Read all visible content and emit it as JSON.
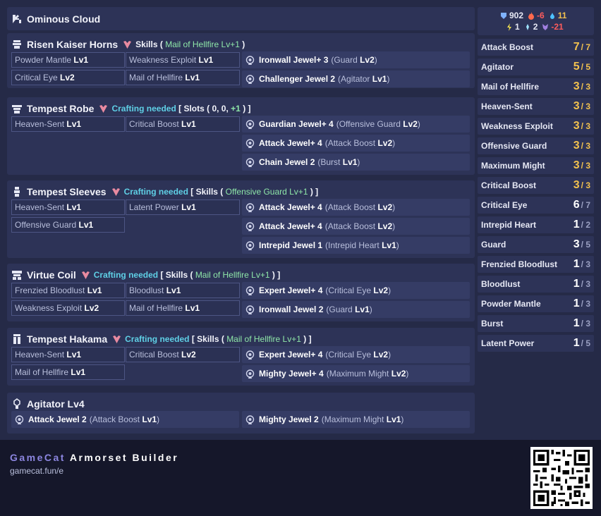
{
  "header": {
    "title": "Ominous Cloud"
  },
  "stats": {
    "defense": "902",
    "fire": "-6",
    "water": "11",
    "thunder": "1",
    "ice": "2",
    "dragon": "-21"
  },
  "armor": [
    {
      "name": "Risen Kaiser Horns",
      "meta_pre": "Skills (",
      "meta_green": "Mail of Hellfire Lv+1",
      "meta_post": ")",
      "skills": [
        "Powder Mantle",
        "Lv1",
        "Weakness Exploit",
        "Lv1",
        "Critical Eye",
        "Lv2",
        "Mail of Hellfire",
        "Lv1"
      ],
      "jewels": [
        {
          "name": "Ironwall Jewel+ 3",
          "skill": "Guard",
          "level": "Lv2"
        },
        {
          "name": "Challenger Jewel 2",
          "skill": "Agitator",
          "level": "Lv1"
        }
      ]
    },
    {
      "name": "Tempest Robe",
      "meta_craft": "Crafting needed",
      "meta_pre": "[ Slots ( 0, 0,",
      "meta_plus": "+1",
      "meta_post": ") ]",
      "skills": [
        "Heaven-Sent",
        "Lv1",
        "Critical Boost",
        "Lv1"
      ],
      "jewels": [
        {
          "name": "Guardian Jewel+ 4",
          "skill": "Offensive Guard",
          "level": "Lv2"
        },
        {
          "name": "Attack Jewel+ 4",
          "skill": "Attack Boost",
          "level": "Lv2"
        },
        {
          "name": "Chain Jewel 2",
          "skill": "Burst",
          "level": "Lv1"
        }
      ]
    },
    {
      "name": "Tempest Sleeves",
      "meta_craft": "Crafting needed",
      "meta_pre": "[ Skills (",
      "meta_green": "Offensive Guard Lv+1",
      "meta_post": ") ]",
      "skills": [
        "Heaven-Sent",
        "Lv1",
        "Latent Power",
        "Lv1",
        "Offensive Guard",
        "Lv1"
      ],
      "jewels": [
        {
          "name": "Attack Jewel+ 4",
          "skill": "Attack Boost",
          "level": "Lv2"
        },
        {
          "name": "Attack Jewel+ 4",
          "skill": "Attack Boost",
          "level": "Lv2"
        },
        {
          "name": "Intrepid Jewel 1",
          "skill": "Intrepid Heart",
          "level": "Lv1"
        }
      ]
    },
    {
      "name": "Virtue Coil",
      "meta_craft": "Crafting needed",
      "meta_pre": "[ Skills (",
      "meta_green": "Mail of Hellfire Lv+1",
      "meta_post": ") ]",
      "skills": [
        "Frenzied Bloodlust",
        "Lv1",
        "Bloodlust",
        "Lv1",
        "Weakness Exploit",
        "Lv2",
        "Mail of Hellfire",
        "Lv1"
      ],
      "jewels": [
        {
          "name": "Expert Jewel+ 4",
          "skill": "Critical Eye",
          "level": "Lv2"
        },
        {
          "name": "Ironwall Jewel 2",
          "skill": "Guard",
          "level": "Lv1"
        }
      ]
    },
    {
      "name": "Tempest Hakama",
      "meta_craft": "Crafting needed",
      "meta_pre": "[ Skills (",
      "meta_green": "Mail of Hellfire Lv+1",
      "meta_post": ") ]",
      "skills": [
        "Heaven-Sent",
        "Lv1",
        "Critical Boost",
        "Lv2",
        "Mail of Hellfire",
        "Lv1"
      ],
      "jewels": [
        {
          "name": "Expert Jewel+ 4",
          "skill": "Critical Eye",
          "level": "Lv2"
        },
        {
          "name": "Mighty Jewel+ 4",
          "skill": "Maximum Might",
          "level": "Lv2"
        }
      ]
    }
  ],
  "charm": {
    "name": "Agitator Lv4",
    "jewels": [
      {
        "name": "Attack Jewel 2",
        "skill": "Attack Boost",
        "level": "Lv1"
      },
      {
        "name": "Mighty Jewel 2",
        "skill": "Maximum Might",
        "level": "Lv1"
      }
    ]
  },
  "skill_totals": [
    {
      "name": "Attack Boost",
      "level": "7",
      "max": "/ 7"
    },
    {
      "name": "Agitator",
      "level": "5",
      "max": "/ 5"
    },
    {
      "name": "Mail of Hellfire",
      "level": "3",
      "max": "/ 3"
    },
    {
      "name": "Heaven-Sent",
      "level": "3",
      "max": "/ 3"
    },
    {
      "name": "Weakness Exploit",
      "level": "3",
      "max": "/ 3"
    },
    {
      "name": "Offensive Guard",
      "level": "3",
      "max": "/ 3"
    },
    {
      "name": "Maximum Might",
      "level": "3",
      "max": "/ 3"
    },
    {
      "name": "Critical Boost",
      "level": "3",
      "max": "/ 3"
    },
    {
      "name": "Critical Eye",
      "level": "6",
      "max": "/ 7"
    },
    {
      "name": "Intrepid Heart",
      "level": "1",
      "max": "/ 2"
    },
    {
      "name": "Guard",
      "level": "3",
      "max": "/ 5"
    },
    {
      "name": "Frenzied Bloodlust",
      "level": "1",
      "max": "/ 3"
    },
    {
      "name": "Bloodlust",
      "level": "1",
      "max": "/ 3"
    },
    {
      "name": "Powder Mantle",
      "level": "1",
      "max": "/ 3"
    },
    {
      "name": "Burst",
      "level": "1",
      "max": "/ 3"
    },
    {
      "name": "Latent Power",
      "level": "1",
      "max": "/ 5"
    }
  ],
  "footer": {
    "brand_a": "GameCat",
    "brand_b": "Armorset Builder",
    "url": "gamecat.fun/e"
  },
  "colors": {
    "accent_green": "#8ee6a8",
    "accent_cyan": "#5fd0e6",
    "gold": "#f2c14e",
    "negative": "#ff5c5c",
    "brand": "#8c86e0"
  }
}
